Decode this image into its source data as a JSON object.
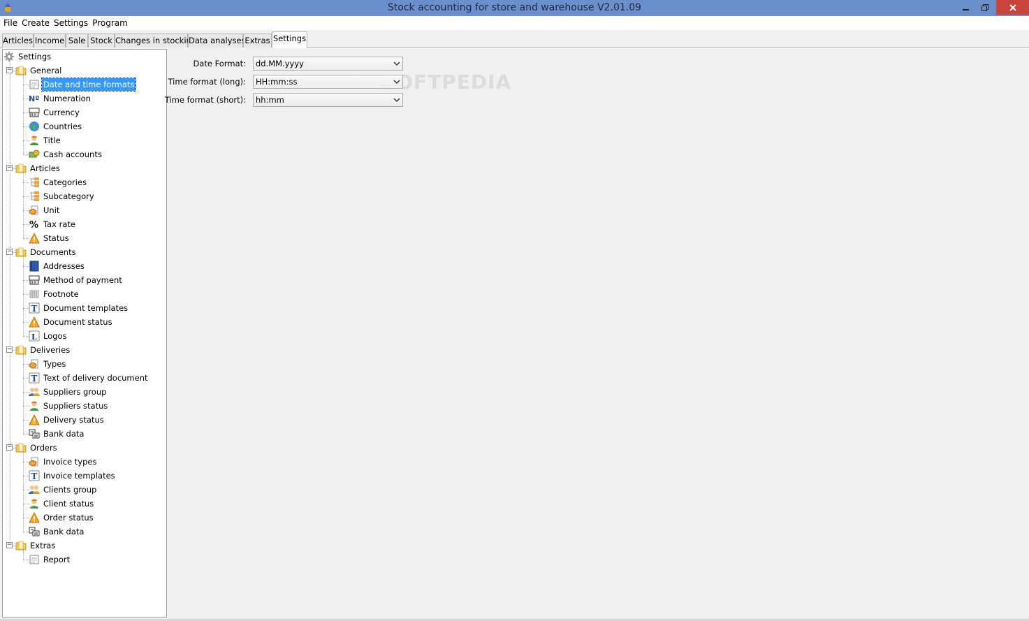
{
  "window": {
    "title": "Stock accounting for store and warehouse V2.01.09",
    "minimize": "—",
    "maximize": "❐",
    "close": "✕"
  },
  "menu": [
    "File",
    "Create",
    "Settings",
    "Program"
  ],
  "tabs": [
    "Articles",
    "Income",
    "Sale",
    "Stock",
    "Changes in stocking",
    "Data analyses",
    "Extras",
    "Settings"
  ],
  "active_tab": "Settings",
  "tree": {
    "root": "Settings",
    "groups": [
      {
        "label": "General",
        "items": [
          {
            "label": "Date and time formats",
            "icon": "document-icon",
            "selected": true
          },
          {
            "label": "Numeration",
            "icon": "numero-icon"
          },
          {
            "label": "Currency",
            "icon": "cash-register-icon"
          },
          {
            "label": "Countries",
            "icon": "globe-icon"
          },
          {
            "label": "Title",
            "icon": "person-icon"
          },
          {
            "label": "Cash accounts",
            "icon": "money-icon"
          }
        ]
      },
      {
        "label": "Articles",
        "items": [
          {
            "label": "Categories",
            "icon": "category-icon"
          },
          {
            "label": "Subcategory",
            "icon": "category-icon"
          },
          {
            "label": "Unit",
            "icon": "unit-icon"
          },
          {
            "label": "Tax rate",
            "icon": "percent-icon"
          },
          {
            "label": "Status",
            "icon": "warning-icon"
          }
        ]
      },
      {
        "label": "Documents",
        "items": [
          {
            "label": "Addresses",
            "icon": "address-book-icon"
          },
          {
            "label": "Method of payment",
            "icon": "cash-register-icon"
          },
          {
            "label": "Footnote",
            "icon": "footnote-icon"
          },
          {
            "label": "Document templates",
            "icon": "text-template-icon"
          },
          {
            "label": "Document status",
            "icon": "warning-icon"
          },
          {
            "label": "Logos",
            "icon": "logo-icon"
          }
        ]
      },
      {
        "label": "Deliveries",
        "items": [
          {
            "label": "Types",
            "icon": "unit-icon"
          },
          {
            "label": "Text of delivery document",
            "icon": "text-template-icon"
          },
          {
            "label": "Suppliers group",
            "icon": "group-icon"
          },
          {
            "label": "Suppliers status",
            "icon": "person-icon"
          },
          {
            "label": "Delivery status",
            "icon": "warning-icon"
          },
          {
            "label": "Bank data",
            "icon": "bank-icon"
          }
        ]
      },
      {
        "label": "Orders",
        "items": [
          {
            "label": "Invoice types",
            "icon": "unit-icon"
          },
          {
            "label": "Invoice templates",
            "icon": "text-template-icon"
          },
          {
            "label": "Clients group",
            "icon": "group-icon"
          },
          {
            "label": "Client status",
            "icon": "person-icon"
          },
          {
            "label": "Order status",
            "icon": "warning-icon"
          },
          {
            "label": "Bank data",
            "icon": "bank-icon"
          }
        ]
      },
      {
        "label": "Extras",
        "items": [
          {
            "label": "Report",
            "icon": "document-icon"
          }
        ]
      }
    ]
  },
  "form": {
    "date_format": {
      "label": "Date Format:",
      "value": "dd.MM.yyyy"
    },
    "time_long": {
      "label": "Time format (long):",
      "value": "HH:mm:ss"
    },
    "time_short": {
      "label": "Time format (short):",
      "value": "hh:mm"
    }
  },
  "watermark": "SOFTPEDIA",
  "colors": {
    "titlebar": "#6b8fcb",
    "close_button": "#c7453a",
    "selection": "#3399ff"
  }
}
